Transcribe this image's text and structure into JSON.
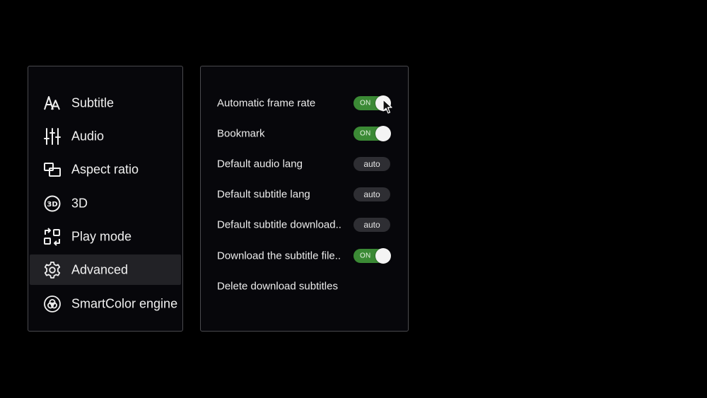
{
  "menu": {
    "items": [
      {
        "label": "Subtitle",
        "icon": "subtitle-icon",
        "active": false
      },
      {
        "label": "Audio",
        "icon": "equalizer-icon",
        "active": false
      },
      {
        "label": "Aspect ratio",
        "icon": "aspect-ratio-icon",
        "active": false
      },
      {
        "label": "3D",
        "icon": "3d-icon",
        "active": false
      },
      {
        "label": "Play mode",
        "icon": "play-mode-icon",
        "active": false
      },
      {
        "label": "Advanced",
        "icon": "gear-icon",
        "active": true
      },
      {
        "label": "SmartColor engine",
        "icon": "smartcolor-icon",
        "active": false
      }
    ]
  },
  "settings": {
    "rows": [
      {
        "label": "Automatic frame rate",
        "type": "toggle",
        "value": "ON"
      },
      {
        "label": "Bookmark",
        "type": "toggle",
        "value": "ON"
      },
      {
        "label": "Default audio lang",
        "type": "value",
        "value": "auto"
      },
      {
        "label": "Default subtitle lang",
        "type": "value",
        "value": "auto"
      },
      {
        "label": "Default subtitle download..",
        "type": "value",
        "value": "auto"
      },
      {
        "label": "Download the subtitle file..",
        "type": "toggle",
        "value": "ON"
      },
      {
        "label": "Delete download subtitles",
        "type": "action",
        "value": ""
      }
    ]
  },
  "colors": {
    "toggle_on": "#3b8a35",
    "value_pill": "#2e2e33",
    "active_item": "#222226",
    "panel_bg": "#07070b",
    "panel_border": "#4a4a4e"
  }
}
